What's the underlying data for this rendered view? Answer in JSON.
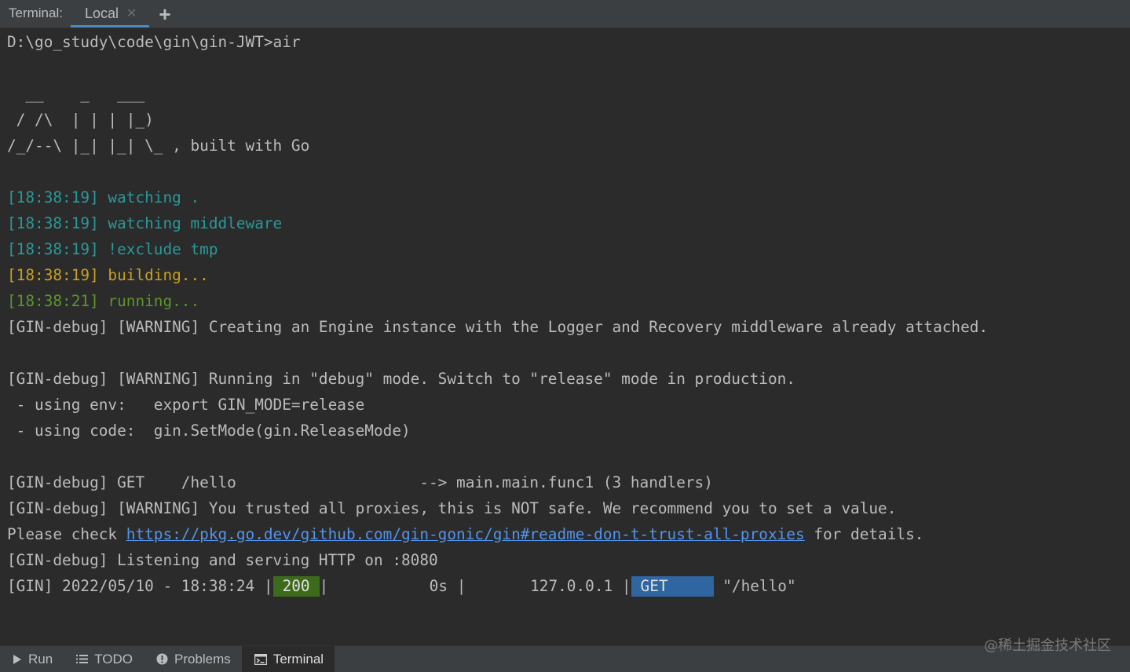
{
  "tabbar": {
    "label": "Terminal:",
    "tabs": [
      {
        "label": "Local",
        "active": true
      }
    ],
    "add_label": "+"
  },
  "terminal": {
    "lines": [
      {
        "kind": "plain",
        "text": "D:\\go_study\\code\\gin\\gin-JWT>air"
      },
      {
        "kind": "plain",
        "text": ""
      },
      {
        "kind": "plain",
        "text": "  __    _   ___"
      },
      {
        "kind": "plain",
        "text": " / /\\  | | | |_)"
      },
      {
        "kind": "plain",
        "text": "/_/--\\ |_| |_| \\_ , built with Go"
      },
      {
        "kind": "plain",
        "text": ""
      },
      {
        "kind": "cyan",
        "text": "[18:38:19] watching ."
      },
      {
        "kind": "cyan",
        "text": "[18:38:19] watching middleware"
      },
      {
        "kind": "cyan",
        "text": "[18:38:19] !exclude tmp"
      },
      {
        "kind": "gold",
        "text": "[18:38:19] building..."
      },
      {
        "kind": "green",
        "text": "[18:38:21] running..."
      },
      {
        "kind": "plain",
        "text": "[GIN-debug] [WARNING] Creating an Engine instance with the Logger and Recovery middleware already attached."
      },
      {
        "kind": "plain",
        "text": ""
      },
      {
        "kind": "plain",
        "text": "[GIN-debug] [WARNING] Running in \"debug\" mode. Switch to \"release\" mode in production."
      },
      {
        "kind": "plain",
        "text": " - using env:   export GIN_MODE=release"
      },
      {
        "kind": "plain",
        "text": " - using code:  gin.SetMode(gin.ReleaseMode)"
      },
      {
        "kind": "plain",
        "text": ""
      },
      {
        "kind": "plain",
        "text": "[GIN-debug] GET    /hello                    --> main.main.func1 (3 handlers)"
      },
      {
        "kind": "plain",
        "text": "[GIN-debug] [WARNING] You trusted all proxies, this is NOT safe. We recommend you to set a value."
      }
    ],
    "please_check": {
      "prefix": "Please check ",
      "link": "https://pkg.go.dev/github.com/gin-gonic/gin#readme-don-t-trust-all-proxies",
      "suffix": " for details."
    },
    "listening": "[GIN-debug] Listening and serving HTTP on :8080",
    "request_log": {
      "prefix": "[GIN] 2022/05/10 - 18:38:24 |",
      "status": "200",
      "sep1": "|           0s |       127.0.0.1 |",
      "method": "GET",
      "path": " \"/hello\""
    }
  },
  "toolstrip": {
    "tools": [
      {
        "label": "Run",
        "icon": "play-icon"
      },
      {
        "label": "TODO",
        "icon": "list-icon"
      },
      {
        "label": "Problems",
        "icon": "info-circle-icon"
      },
      {
        "label": "Terminal",
        "icon": "terminal-icon",
        "active": true
      }
    ]
  },
  "watermark": "@稀土掘金技术社区",
  "colors": {
    "background": "#2b2b2b",
    "toolbar": "#3c3f41",
    "accent": "#4a88c7",
    "cyan": "#299999",
    "gold": "#c9a11f",
    "green": "#5c962c",
    "status_ok_bg": "#3d6b1b",
    "method_get_bg": "#2f65a0"
  }
}
